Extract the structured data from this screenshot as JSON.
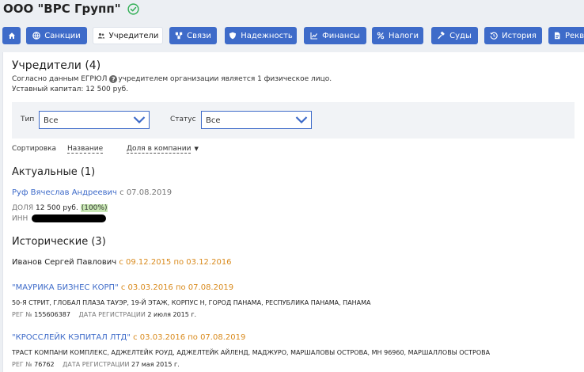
{
  "company": {
    "name": "ООО \"ВРС Групп\""
  },
  "nav": {
    "items": [
      {
        "label": "",
        "icon": "home-icon"
      },
      {
        "label": "Санкции",
        "icon": "globe-icon"
      },
      {
        "label": "Учредители",
        "icon": "people-icon",
        "active": true
      },
      {
        "label": "Связи",
        "icon": "links-icon"
      },
      {
        "label": "Надежность",
        "icon": "shield-icon"
      },
      {
        "label": "Финансы",
        "icon": "chart-icon"
      },
      {
        "label": "Налоги",
        "icon": "percent-icon"
      },
      {
        "label": "Суды",
        "icon": "gavel-icon"
      },
      {
        "label": "История",
        "icon": "history-icon"
      },
      {
        "label": "Рекв",
        "icon": "doc-icon"
      }
    ]
  },
  "main": {
    "title": "Учредители (4)",
    "desc_prefix": "Согласно данным ЕГРЮЛ",
    "desc_suffix": "учредителем организации является 1 физическое лицо.",
    "capital": "Уставный капитал: 12 500 руб.",
    "filter": {
      "type_label": "Тип",
      "type_value": "Все",
      "status_label": "Статус",
      "status_value": "Все"
    },
    "sort": {
      "label": "Сортировка",
      "by_name": "Название",
      "by_share": "Доля в компании"
    },
    "actual": {
      "heading": "Актуальные (1)",
      "person": {
        "name": "Руф Вячеслав Андреевич",
        "date": "с 07.08.2019",
        "share_label": "ДОЛЯ",
        "share_value": "12 500 руб.",
        "share_percent": "(100%)",
        "inn_label": "ИНН"
      }
    },
    "historical": {
      "heading": "Исторические (3)",
      "items": [
        {
          "name": "Иванов Сергей Павлович",
          "dates": "с 09.12.2015 по 03.12.2016"
        },
        {
          "name": "\"МАУРИКА БИЗНЕС КОРП\"",
          "dates": "с 03.03.2016 по 07.08.2019",
          "address": "50-Я СТРИТ, ГЛОБАЛ ПЛАЗА ТАУЭР, 19-Й ЭТАЖ, КОРПУС Н, ГОРОД ПАНАМА, РЕСПУБЛИКА ПАНАМА, ПАНАМА",
          "reg_label": "РЕГ №",
          "reg_value": "155606387",
          "date_label": "ДАТА РЕГИСТРАЦИИ",
          "date_value": "2 июля 2015 г."
        },
        {
          "name": "\"КРОССЛЕЙК КЭПИТАЛ ЛТД\"",
          "dates": "с 03.03.2016 по 07.08.2019",
          "address": "ТРАСТ КОМПАНИ КОМПЛЕКС, АДЖЕЛТЕЙК РОУД, АДЖЕЛТЕЙК АЙЛЕНД, МАДЖУРО, МАРШАЛОВЫ ОСТРОВА, МН 96960, МАРШАЛЛОВЫ ОСТРОВА",
          "reg_label": "РЕГ №",
          "reg_value": "76762",
          "date_label": "ДАТА РЕГИСТРАЦИИ",
          "date_value": "27 мая 2015 г."
        }
      ]
    }
  },
  "colors": {
    "accent": "#3e6bc9",
    "orange": "#d98a1c",
    "check": "#2fae53"
  }
}
